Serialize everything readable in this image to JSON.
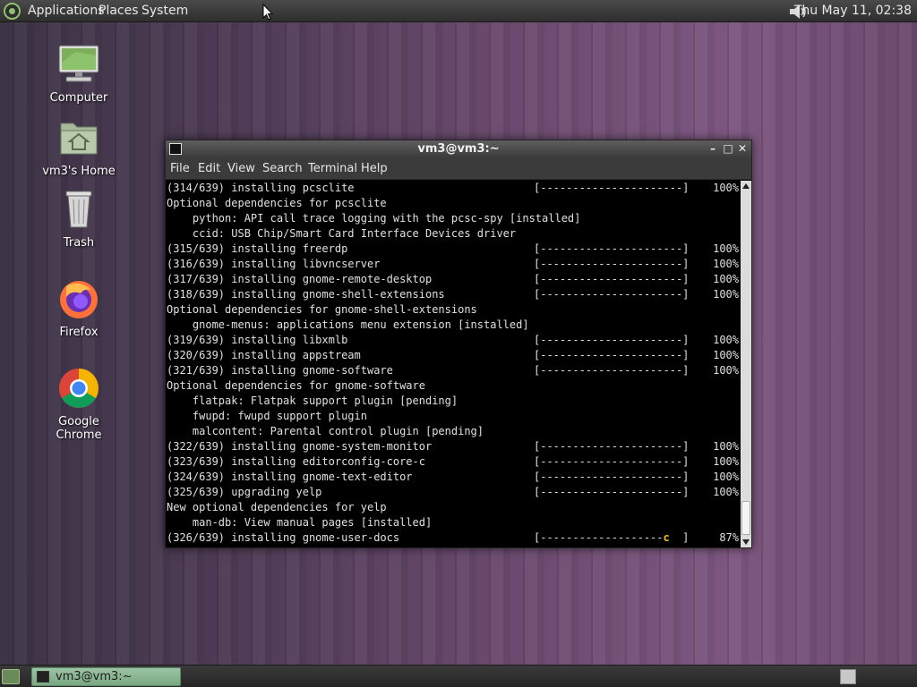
{
  "top_panel": {
    "menu": [
      "Applications",
      "Places",
      "System"
    ],
    "clock": "Thu May 11, 02:38",
    "volume_icon": "speaker-icon"
  },
  "desktop_icons": [
    {
      "label": "Computer",
      "icon": "computer-icon"
    },
    {
      "label": "vm3's Home",
      "icon": "home-folder-icon"
    },
    {
      "label": "Trash",
      "icon": "trash-icon"
    },
    {
      "label": "Firefox",
      "icon": "firefox-icon"
    },
    {
      "label": "Google Chrome",
      "icon": "chrome-icon"
    }
  ],
  "window": {
    "title": "vm3@vm3:~",
    "menu": [
      "File",
      "Edit",
      "View",
      "Search",
      "Terminal",
      "Help"
    ],
    "lines": [
      {
        "text": "(314/639) installing pcsclite",
        "bar": "[----------------------]",
        "pct": "100%"
      },
      {
        "text": "Optional dependencies for pcsclite"
      },
      {
        "text": "    python: API call trace logging with the pcsc-spy [installed]"
      },
      {
        "text": "    ccid: USB Chip/Smart Card Interface Devices driver"
      },
      {
        "text": "(315/639) installing freerdp",
        "bar": "[----------------------]",
        "pct": "100%"
      },
      {
        "text": "(316/639) installing libvncserver",
        "bar": "[----------------------]",
        "pct": "100%"
      },
      {
        "text": "(317/639) installing gnome-remote-desktop",
        "bar": "[----------------------]",
        "pct": "100%"
      },
      {
        "text": "(318/639) installing gnome-shell-extensions",
        "bar": "[----------------------]",
        "pct": "100%"
      },
      {
        "text": "Optional dependencies for gnome-shell-extensions"
      },
      {
        "text": "    gnome-menus: applications menu extension [installed]"
      },
      {
        "text": "(319/639) installing libxmlb",
        "bar": "[----------------------]",
        "pct": "100%"
      },
      {
        "text": "(320/639) installing appstream",
        "bar": "[----------------------]",
        "pct": "100%"
      },
      {
        "text": "(321/639) installing gnome-software",
        "bar": "[----------------------]",
        "pct": "100%"
      },
      {
        "text": "Optional dependencies for gnome-software"
      },
      {
        "text": "    flatpak: Flatpak support plugin [pending]"
      },
      {
        "text": "    fwupd: fwupd support plugin"
      },
      {
        "text": "    malcontent: Parental control plugin [pending]"
      },
      {
        "text": "(322/639) installing gnome-system-monitor",
        "bar": "[----------------------]",
        "pct": "100%"
      },
      {
        "text": "(323/639) installing editorconfig-core-c",
        "bar": "[----------------------]",
        "pct": "100%"
      },
      {
        "text": "(324/639) installing gnome-text-editor",
        "bar": "[----------------------]",
        "pct": "100%"
      },
      {
        "text": "(325/639) upgrading yelp",
        "bar": "[----------------------]",
        "pct": "100%"
      },
      {
        "text": "New optional dependencies for yelp"
      },
      {
        "text": "    man-db: View manual pages [installed]"
      },
      {
        "text": "(326/639) installing gnome-user-docs",
        "bar": "[-------------------",
        "cursor": "c",
        "bar_end": "  ]",
        "pct": "87%"
      }
    ]
  },
  "taskbar": {
    "task_label": "vm3@vm3:~"
  }
}
